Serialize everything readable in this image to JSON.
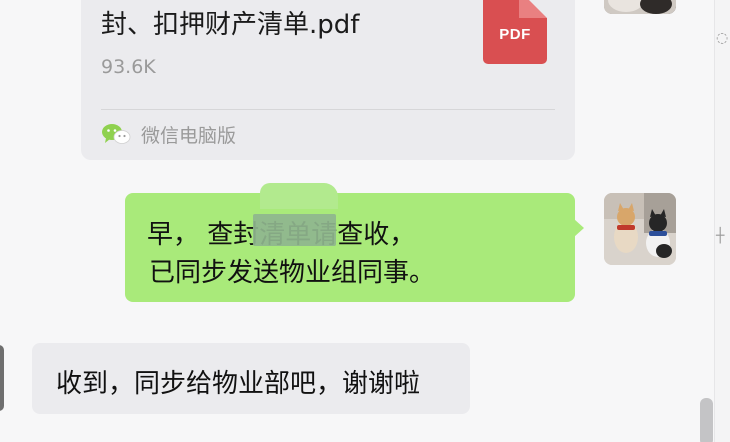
{
  "file_message": {
    "file_name": "封、扣押财产清单.pdf",
    "file_size": "93.6K",
    "file_type_label": "PDF",
    "file_type_icon": "pdf-file-icon",
    "source_label": "微信电脑版",
    "source_icon": "wechat-icon"
  },
  "outgoing_message": {
    "line1": "早，         查封清单请查收，",
    "line2": "已同步发送物业组同事。",
    "redacted": true
  },
  "incoming_message": {
    "text": "收到，同步给物业部吧，谢谢啦"
  },
  "colors": {
    "outgoing_bubble": "#a9ea7a",
    "incoming_bubble": "#ebebee",
    "pdf_icon": "#d94f51",
    "background": "#f7f7f8"
  }
}
